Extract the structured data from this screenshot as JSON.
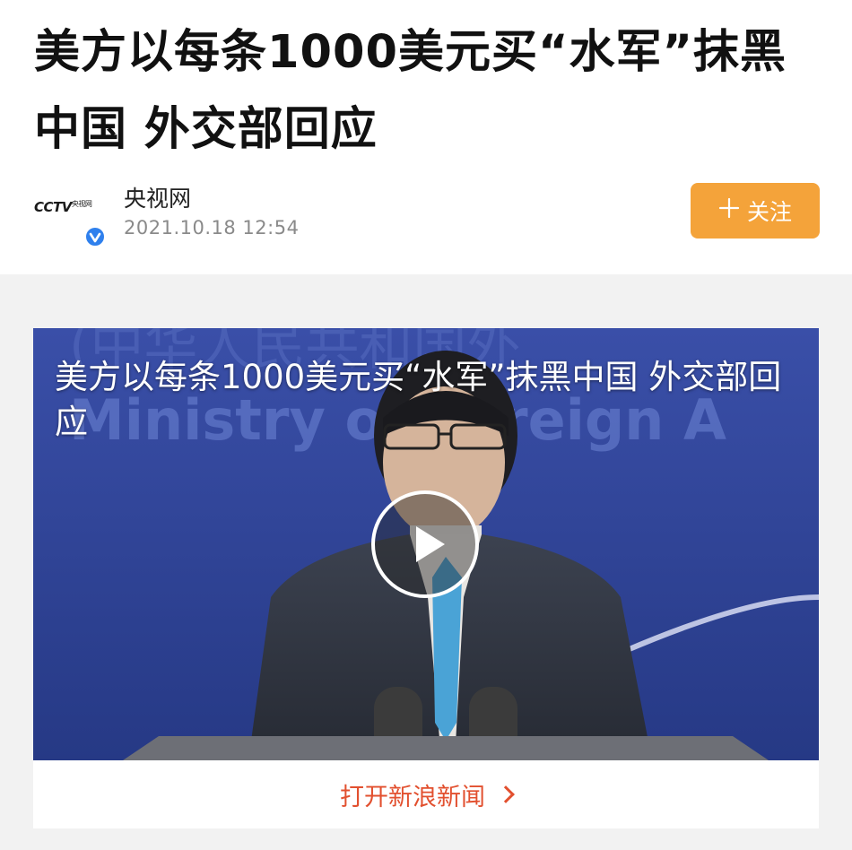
{
  "article": {
    "title": "美方以每条1000美元买“水军”抹黑中国 外交部回应"
  },
  "author": {
    "avatar_text": "CCTV",
    "avatar_sub": "央视网",
    "name": "央视网",
    "time": "2021.10.18  12:54",
    "verified_icon": "verified-check-icon"
  },
  "follow_button": {
    "icon": "plus-icon",
    "label": "关注",
    "color": "#f4a33a"
  },
  "video": {
    "title": "美方以每条1000美元买“水军”抹黑中国 外交部回应",
    "background_text_cn": "(中华人民共和国外",
    "background_text_en": "Ministry of Foreign A",
    "play_icon": "play-icon"
  },
  "open_app_link": {
    "label": "打开新浪新闻",
    "icon": "chevron-right-icon",
    "color": "#e2502f"
  }
}
